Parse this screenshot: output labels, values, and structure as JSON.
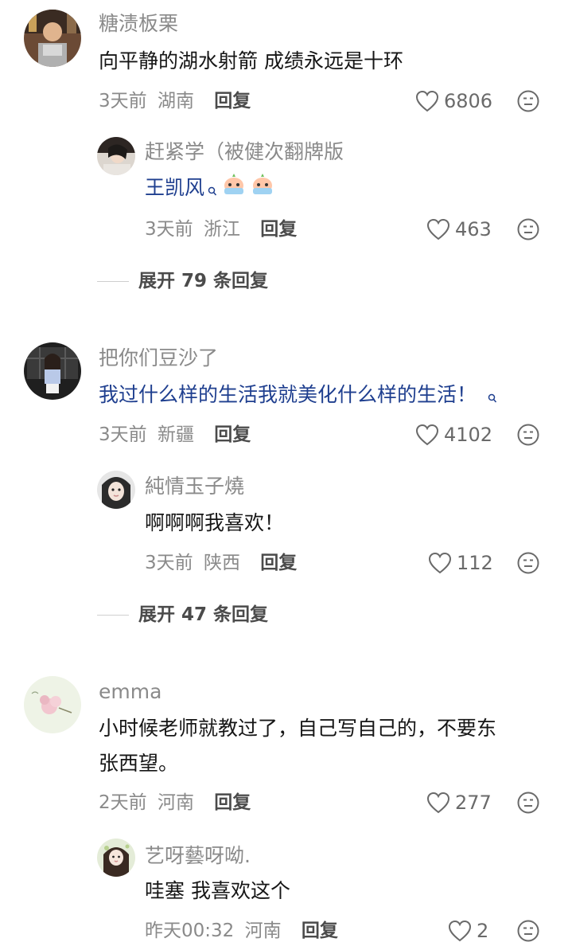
{
  "comments": [
    {
      "username": "糖渍板栗",
      "content": "向平静的湖水射箭 成绩永远是十环",
      "time": "3天前",
      "location": "湖南",
      "reply_label": "回复",
      "likes": "6806",
      "reply": {
        "username": "赶紧学（被健次翻牌版",
        "content": "王凯风",
        "time": "3天前",
        "location": "浙江",
        "reply_label": "回复",
        "likes": "463"
      },
      "expand_label": "展开 79 条回复"
    },
    {
      "username": "把你们豆沙了",
      "content": "我过什么样的生活我就美化什么样的生活！",
      "time": "3天前",
      "location": "新疆",
      "reply_label": "回复",
      "likes": "4102",
      "reply": {
        "username": "純情玉子燒",
        "content": "啊啊啊我喜欢！",
        "time": "3天前",
        "location": "陕西",
        "reply_label": "回复",
        "likes": "112"
      },
      "expand_label": "展开 47 条回复"
    },
    {
      "username": "emma",
      "content_line1": "小时候老师就教过了，自己写自己的，不要东",
      "content_line2": "张西望。",
      "time": "2天前",
      "location": "河南",
      "reply_label": "回复",
      "likes": "277",
      "reply": {
        "username": "艺呀藝呀呦.",
        "content": "哇塞 我喜欢这个",
        "time": "昨天00:32",
        "location": "河南",
        "reply_label": "回复",
        "likes": "2"
      }
    }
  ],
  "colors": {
    "text_primary": "#161616",
    "text_secondary": "#8a8a8a",
    "link_blue": "#1f3f8f"
  }
}
